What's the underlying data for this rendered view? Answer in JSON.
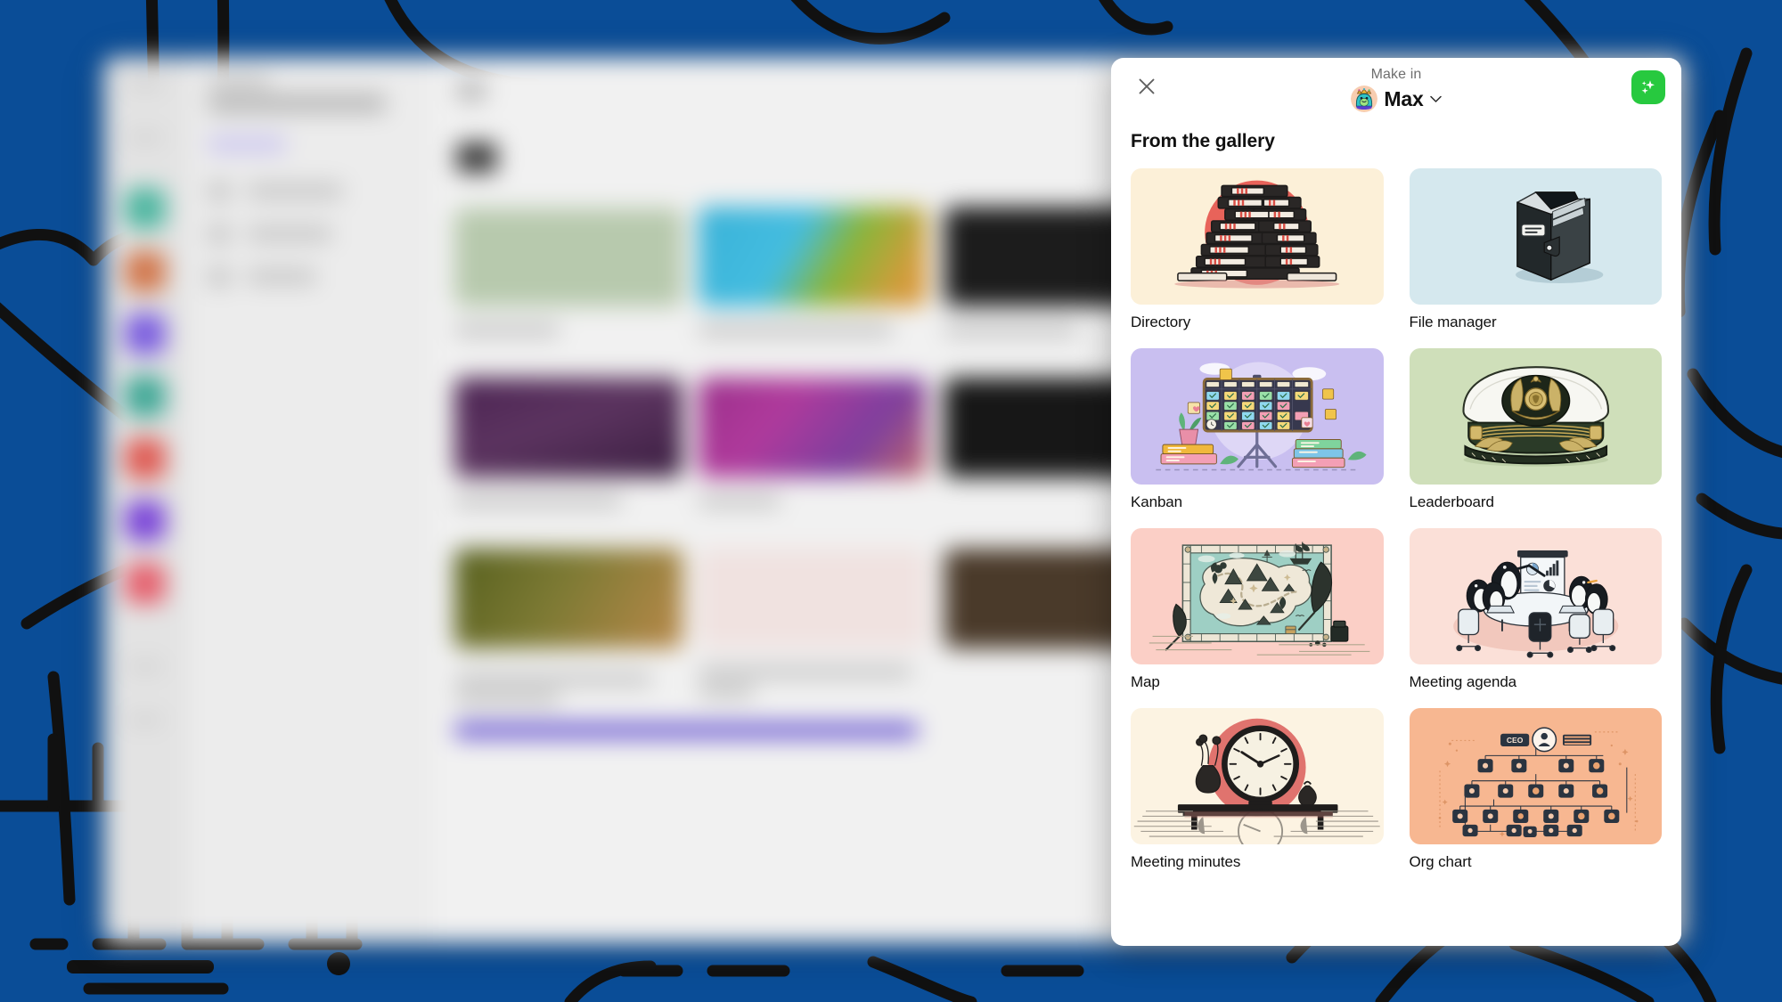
{
  "theme": {
    "page_background": "#0a4d97",
    "panel_background": "#ffffff",
    "accent_green": "#27c93f",
    "heading_color": "#101010",
    "muted_text": "#6e6e6e"
  },
  "panel": {
    "close_icon": "close-icon",
    "make_in_label": "Make in",
    "persona_name": "Max",
    "persona_chevron_icon": "chevron-down-icon",
    "sparkle_icon": "sparkles-icon",
    "gallery_heading": "From the gallery"
  },
  "gallery": {
    "items": [
      {
        "label": "Directory",
        "icon": "binder-stack-icon",
        "bg": "#fcf0d8"
      },
      {
        "label": "File manager",
        "icon": "organizer-book-icon",
        "bg": "#d5e8ee"
      },
      {
        "label": "Kanban",
        "icon": "kanban-board-icon",
        "bg": "#c9bff0"
      },
      {
        "label": "Leaderboard",
        "icon": "captain-hat-icon",
        "bg": "#cfdfba"
      },
      {
        "label": "Map",
        "icon": "treasure-map-icon",
        "bg": "#fbcfc6"
      },
      {
        "label": "Meeting agenda",
        "icon": "penguin-meeting-icon",
        "bg": "#fbe0d8"
      },
      {
        "label": "Meeting minutes",
        "icon": "mantel-clock-icon",
        "bg": "#fcf3e2"
      },
      {
        "label": "Org chart",
        "icon": "org-chart-icon",
        "bg": "#f7b791"
      }
    ]
  }
}
